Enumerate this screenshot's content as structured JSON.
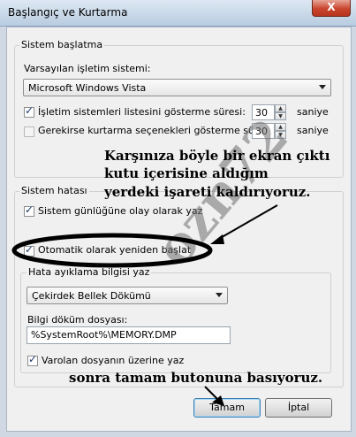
{
  "window": {
    "title": "Başlangıç ve Kurtarma",
    "close_label": "X"
  },
  "startup": {
    "legend": "Sistem başlatma",
    "default_os_label": "Varsayılan işletim sistemi:",
    "default_os_value": "Microsoft Windows Vista",
    "show_list_label": "İşletim sistemleri listesini gösterme süresi:",
    "show_list_checked": true,
    "show_list_value": "30",
    "show_recovery_label": "Gerekirse kurtarma seçenekleri gösterme süresi:",
    "show_recovery_checked": false,
    "show_recovery_value": "30",
    "seconds_label": "saniye"
  },
  "failure": {
    "legend": "Sistem hatası",
    "write_event_label": "Sistem günlüğüne olay olarak yaz",
    "auto_restart_label": "Otomatik olarak yeniden başlat",
    "debug_legend": "Hata ayıklama bilgisi yaz",
    "debug_type_value": "Çekirdek Bellek Dökümü",
    "dump_file_label": "Bilgi döküm dosyası:",
    "dump_file_value": "%SystemRoot%\\MEMORY.DMP",
    "overwrite_label": "Varolan dosyanın üzerine yaz"
  },
  "buttons": {
    "ok_label": "Tamam",
    "cancel_label": "İptal"
  },
  "annotations": {
    "line1": "Karşınıza böyle bir ekran çıktı",
    "line2": "kutu içerisine aldığım",
    "line3": "yerdeki işareti kaldırıyoruz.",
    "line4": "sonra tamam butonuna basıyoruz.",
    "watermark": "ozn72"
  },
  "checkmark": "✓",
  "spin_up": "▲",
  "spin_down": "▼"
}
